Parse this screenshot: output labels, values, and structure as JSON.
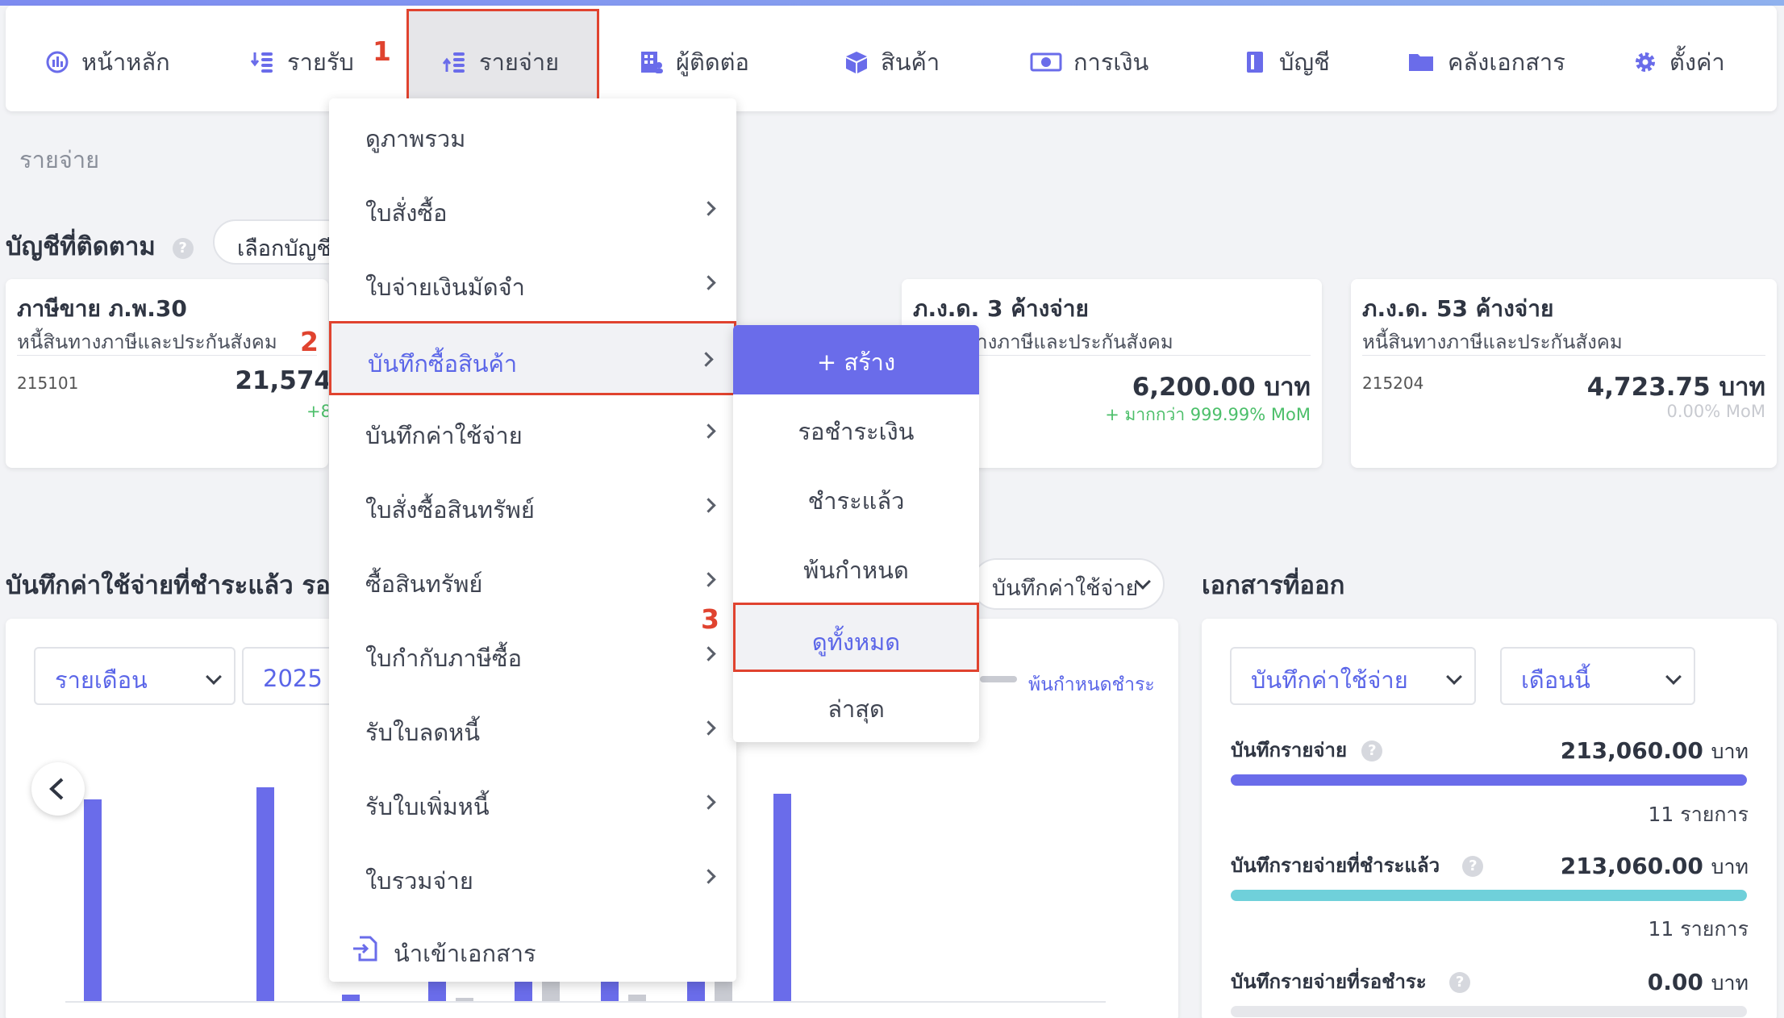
{
  "nav": {
    "items": [
      {
        "label": "หน้าหลัก",
        "icon": "chart-circle-icon"
      },
      {
        "label": "รายรับ",
        "icon": "income-icon"
      },
      {
        "label": "รายจ่าย",
        "icon": "expense-icon"
      },
      {
        "label": "ผู้ติดต่อ",
        "icon": "contacts-icon"
      },
      {
        "label": "สินค้า",
        "icon": "box-icon"
      },
      {
        "label": "การเงิน",
        "icon": "money-icon"
      },
      {
        "label": "บัญชี",
        "icon": "ledger-icon"
      },
      {
        "label": "คลังเอกสาร",
        "icon": "folder-icon"
      },
      {
        "label": "ตั้งค่า",
        "icon": "gear-icon"
      }
    ],
    "active": "รายจ่าย"
  },
  "annotations": [
    "1",
    "2",
    "3"
  ],
  "breadcrumb": "รายจ่าย",
  "watched": {
    "title": "บัญชีที่ติดตาม",
    "help": "?",
    "select_label": "เลือกบัญชี",
    "cards": [
      {
        "title": "ภาษีขาย ภ.พ.30",
        "subtitle": "หนี้สินทางภาษีและประกันสังคม",
        "code": "215101",
        "amount": "21,574",
        "mom": "+8",
        "mom_color": "#4cbf6a"
      },
      {
        "title": "ภ.ง.ด. 3 ค้างจ่าย",
        "subtitle": "หนี้สินทางภาษีและประกันสังคม",
        "code": "",
        "amount": "6,200.00 บาท",
        "mom": "+ มากกว่า 999.99% MoM",
        "mom_color": "#4cbf6a"
      },
      {
        "title": "ภ.ง.ด. 53 ค้างจ่าย",
        "subtitle": "หนี้สินทางภาษีและประกันสังคม",
        "code": "215204",
        "amount": "4,723.75 บาท",
        "mom": "0.00% MoM",
        "mom_color": "#c8cad0"
      }
    ]
  },
  "chart_section": {
    "title": "บันทึกค่าใช้จ่ายที่ชำระแล้ว รอชำ",
    "doc_select": "บันทึกค่าใช้จ่าย",
    "period_select": "รายเดือน",
    "year_select": "2025",
    "legend_overdue": "พ้นกำหนดชำระ"
  },
  "chart_data": {
    "type": "bar",
    "series": [
      {
        "color": "#6a6cea",
        "values": [
          0.64,
          0.68,
          0.02,
          0.2,
          0.2,
          0.2,
          0.2,
          0.66
        ]
      },
      {
        "color": "#c9cbd2",
        "values": [
          0,
          0,
          0,
          0.01,
          0.1,
          0.02,
          0.1,
          0
        ]
      }
    ]
  },
  "docs_issued": {
    "title": "เอกสารที่ออก",
    "doc_select": "บันทึกค่าใช้จ่าย",
    "period_select": "เดือนนี้",
    "stats": [
      {
        "label": "บันทึกรายจ่าย",
        "value": "213,060.00",
        "unit": "บาท",
        "count": "11 รายการ",
        "color": "#6a6cea",
        "fill": 1
      },
      {
        "label": "บันทึกรายจ่ายที่ชำระแล้ว",
        "value": "213,060.00",
        "unit": "บาท",
        "count": "11 รายการ",
        "color": "#6fd0da",
        "fill": 1
      },
      {
        "label": "บันทึกรายจ่ายที่รอชำระ",
        "value": "0.00",
        "unit": "บาท",
        "count": "",
        "color": "#e6e7eb",
        "fill": 1
      }
    ]
  },
  "menu": {
    "items": [
      {
        "label": "ดูภาพรวม",
        "arrow": false
      },
      {
        "label": "ใบสั่งซื้อ",
        "arrow": true
      },
      {
        "label": "ใบจ่ายเงินมัดจำ",
        "arrow": true
      },
      {
        "label": "บันทึกซื้อสินค้า",
        "arrow": true
      },
      {
        "label": "บันทึกค่าใช้จ่าย",
        "arrow": true
      },
      {
        "label": "ใบสั่งซื้อสินทรัพย์",
        "arrow": true
      },
      {
        "label": "ซื้อสินทรัพย์",
        "arrow": true
      },
      {
        "label": "ใบกำกับภาษีซื้อ",
        "arrow": true
      },
      {
        "label": "รับใบลดหนี้",
        "arrow": true
      },
      {
        "label": "รับใบเพิ่มหนี้",
        "arrow": true
      },
      {
        "label": "ใบรวมจ่าย",
        "arrow": true
      }
    ],
    "import_label": "นำเข้าเอกสาร"
  },
  "submenu": {
    "create": "+ สร้าง",
    "items": [
      "รอชำระเงิน",
      "ชำระแล้ว",
      "พ้นกำหนด",
      "ดูทั้งหมด",
      "ล่าสุด"
    ]
  }
}
